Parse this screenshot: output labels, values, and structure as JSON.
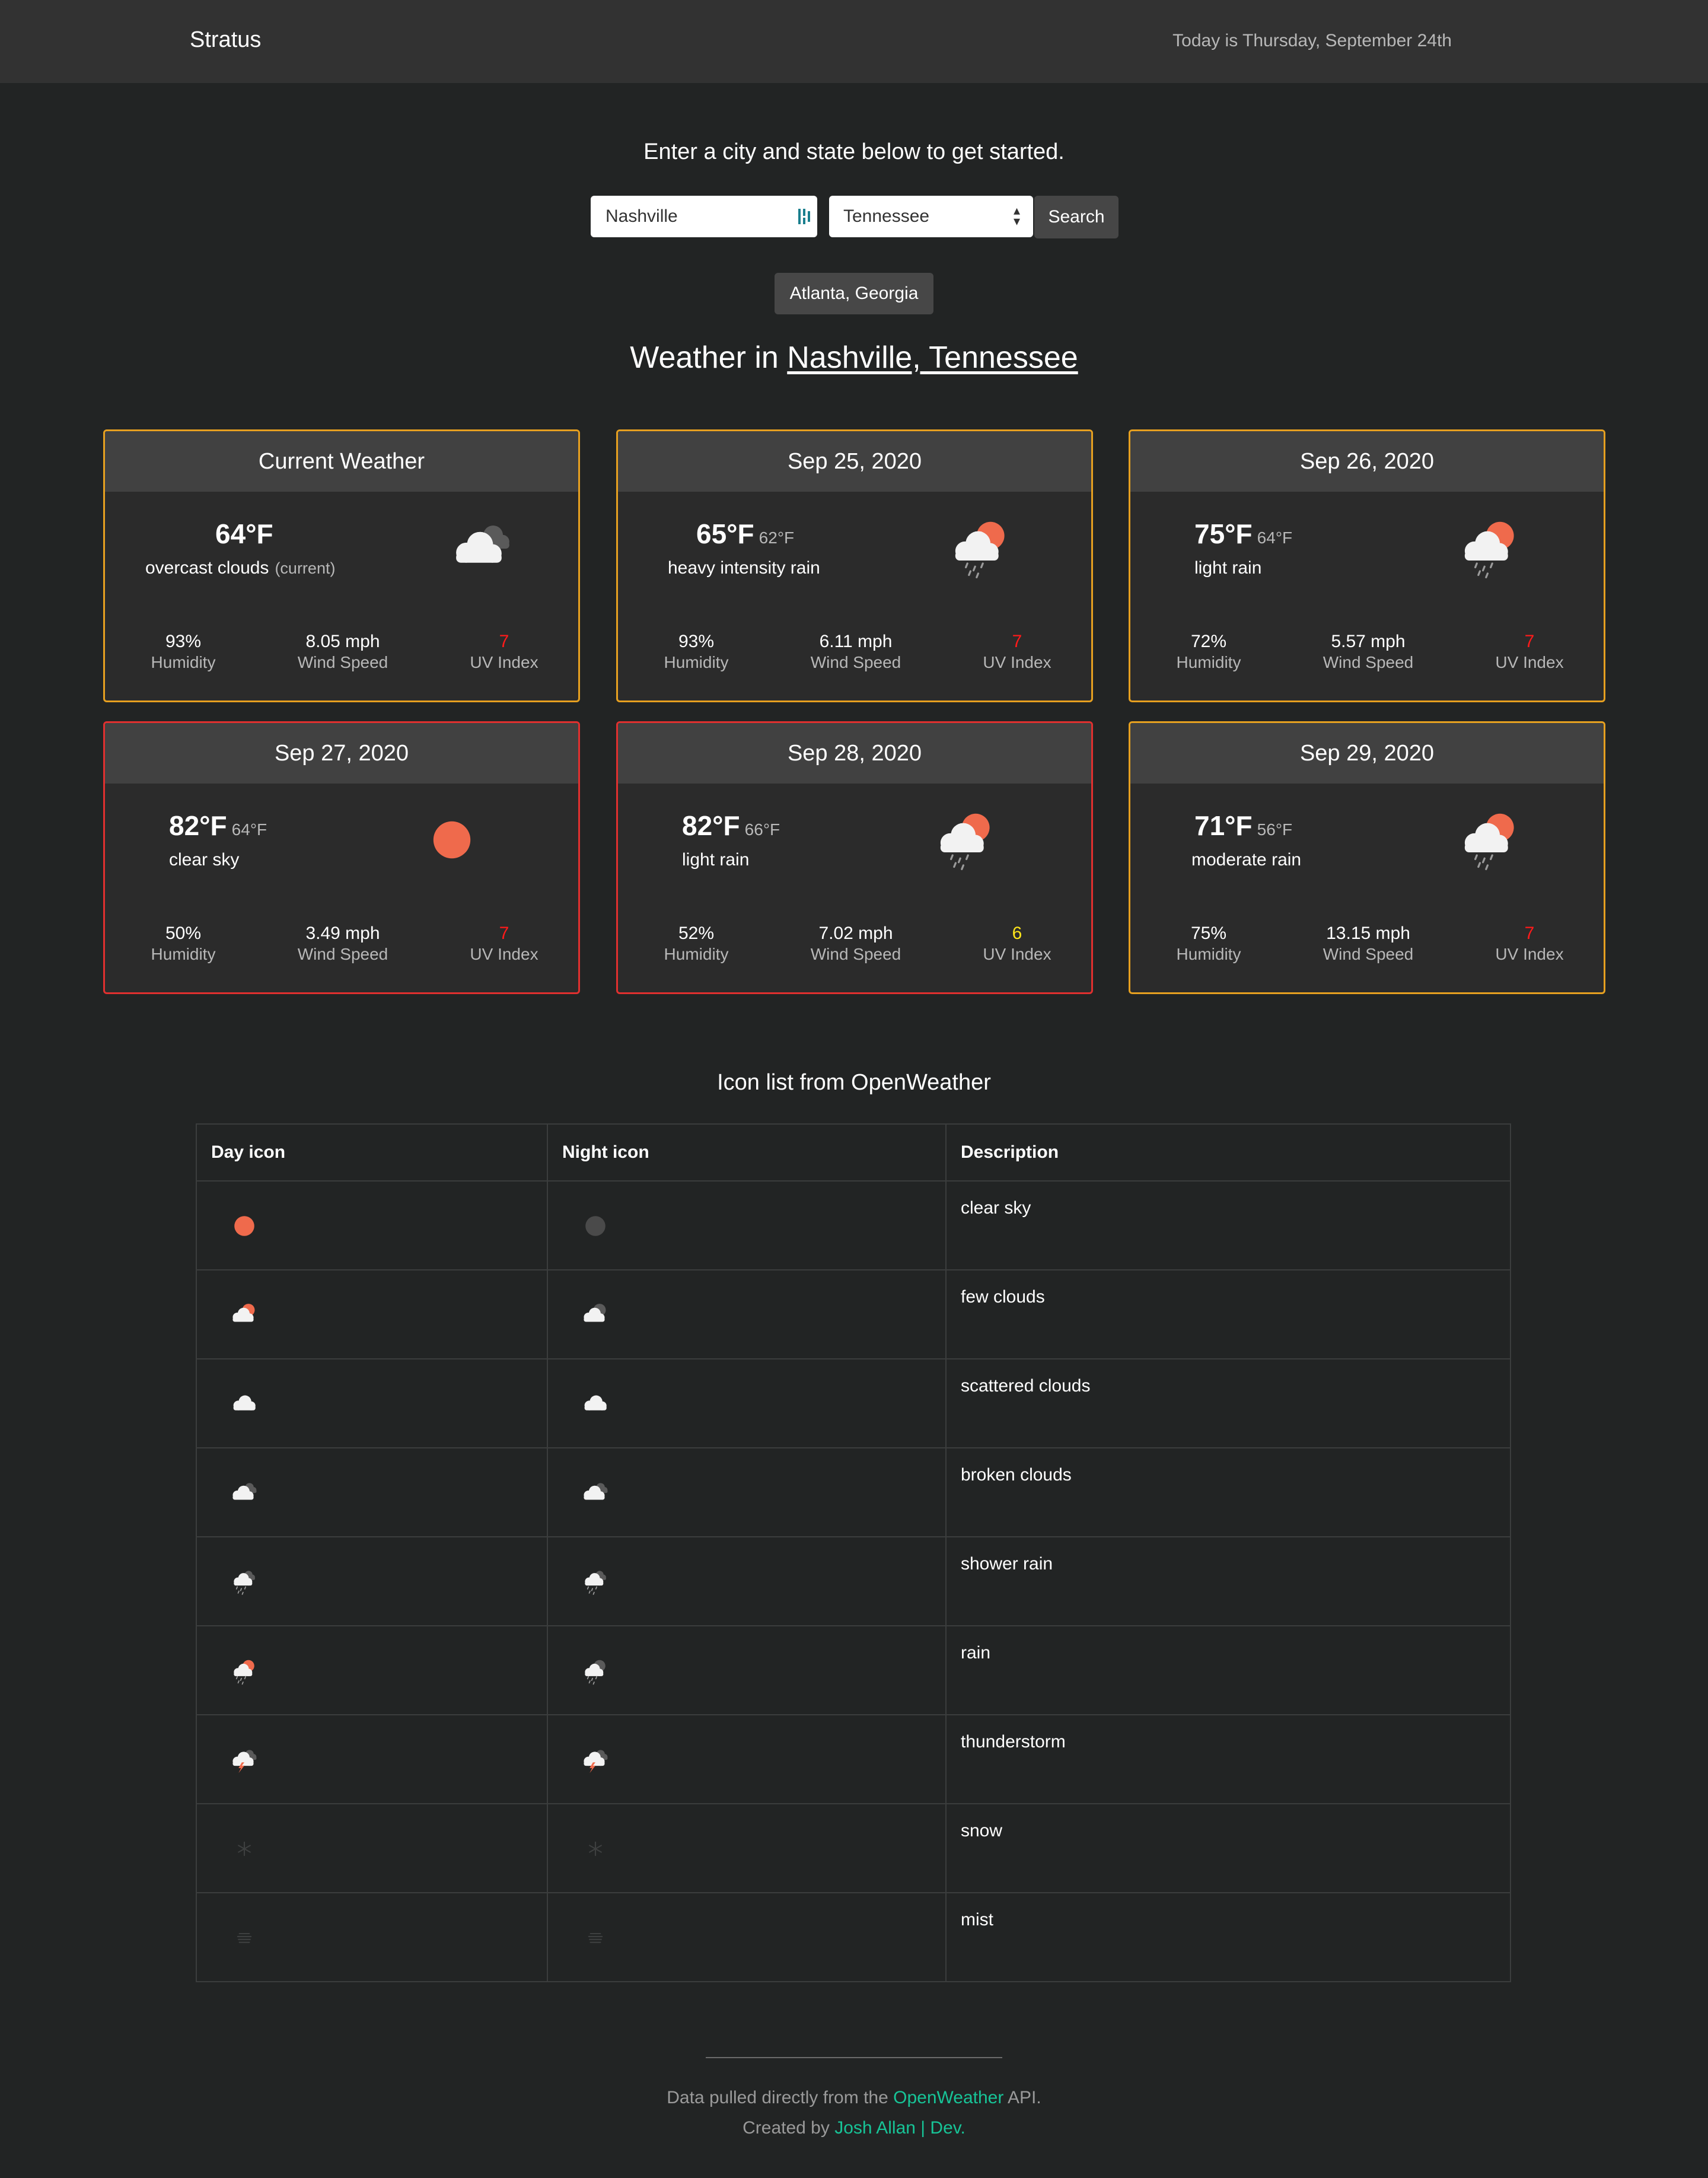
{
  "navbar": {
    "brand": "Stratus",
    "today": "Today is Thursday, September 24th"
  },
  "search": {
    "intro": "Enter a city and state below to get started.",
    "city_value": "Nashville",
    "state_value": "Tennessee",
    "button": "Search"
  },
  "history": [
    "Atlanta, Georgia"
  ],
  "results": {
    "prefix": "Weather in ",
    "location": "Nashville, Tennessee"
  },
  "cards": [
    {
      "title": "Current Weather",
      "temp": "64°F",
      "low": "",
      "desc": "overcast clouds",
      "current": "(current)",
      "icon": "overcast-clouds-icon",
      "humidity": "93%",
      "wind": "8.05 mph",
      "uv": "7",
      "uv_level": "high",
      "border": "orange"
    },
    {
      "title": "Sep 25, 2020",
      "temp": "65°F",
      "low": "62°F",
      "desc": "heavy intensity rain",
      "current": "",
      "icon": "rain-sun-icon",
      "humidity": "93%",
      "wind": "6.11 mph",
      "uv": "7",
      "uv_level": "high",
      "border": "orange"
    },
    {
      "title": "Sep 26, 2020",
      "temp": "75°F",
      "low": "64°F",
      "desc": "light rain",
      "current": "",
      "icon": "rain-sun-icon",
      "humidity": "72%",
      "wind": "5.57 mph",
      "uv": "7",
      "uv_level": "high",
      "border": "orange"
    },
    {
      "title": "Sep 27, 2020",
      "temp": "82°F",
      "low": "64°F",
      "desc": "clear sky",
      "current": "",
      "icon": "sun-icon",
      "humidity": "50%",
      "wind": "3.49 mph",
      "uv": "7",
      "uv_level": "high",
      "border": "red"
    },
    {
      "title": "Sep 28, 2020",
      "temp": "82°F",
      "low": "66°F",
      "desc": "light rain",
      "current": "",
      "icon": "rain-sun-icon",
      "humidity": "52%",
      "wind": "7.02 mph",
      "uv": "6",
      "uv_level": "moderate",
      "border": "red"
    },
    {
      "title": "Sep 29, 2020",
      "temp": "71°F",
      "low": "56°F",
      "desc": "moderate rain",
      "current": "",
      "icon": "rain-sun-icon",
      "humidity": "75%",
      "wind": "13.15 mph",
      "uv": "7",
      "uv_level": "high",
      "border": "orange"
    }
  ],
  "labels": {
    "humidity": "Humidity",
    "wind": "Wind Speed",
    "uv": "UV Index"
  },
  "icon_list": {
    "title": "Icon list from OpenWeather",
    "headers": [
      "Day icon",
      "Night icon",
      "Description"
    ],
    "rows": [
      {
        "day": "sun-icon",
        "night": "moon-icon",
        "desc": "clear sky"
      },
      {
        "day": "few-clouds-day-icon",
        "night": "few-clouds-night-icon",
        "desc": "few clouds"
      },
      {
        "day": "cloud-icon",
        "night": "cloud-icon",
        "desc": "scattered clouds"
      },
      {
        "day": "broken-clouds-icon",
        "night": "broken-clouds-icon",
        "desc": "broken clouds"
      },
      {
        "day": "shower-rain-icon",
        "night": "shower-rain-icon",
        "desc": "shower rain"
      },
      {
        "day": "rain-day-icon",
        "night": "rain-night-icon",
        "desc": "rain"
      },
      {
        "day": "thunderstorm-icon",
        "night": "thunderstorm-icon",
        "desc": "thunderstorm"
      },
      {
        "day": "snow-icon",
        "night": "snow-icon",
        "desc": "snow"
      },
      {
        "day": "mist-icon",
        "night": "mist-icon",
        "desc": "mist"
      }
    ]
  },
  "footer": {
    "line1_pre": "Data pulled directly from the ",
    "line1_link": "OpenWeather",
    "line1_post": " API.",
    "line2_pre": "Created by ",
    "line2_link": "Josh Allan | Dev."
  },
  "colors": {
    "background": "#222424",
    "navbar": "#323232",
    "card_orange": "#e6a020",
    "card_red": "#e0302f",
    "sun": "#ef6a4c",
    "uv_high": "#ff1a1a",
    "uv_moderate": "#ffe51a",
    "link": "#17c497"
  }
}
